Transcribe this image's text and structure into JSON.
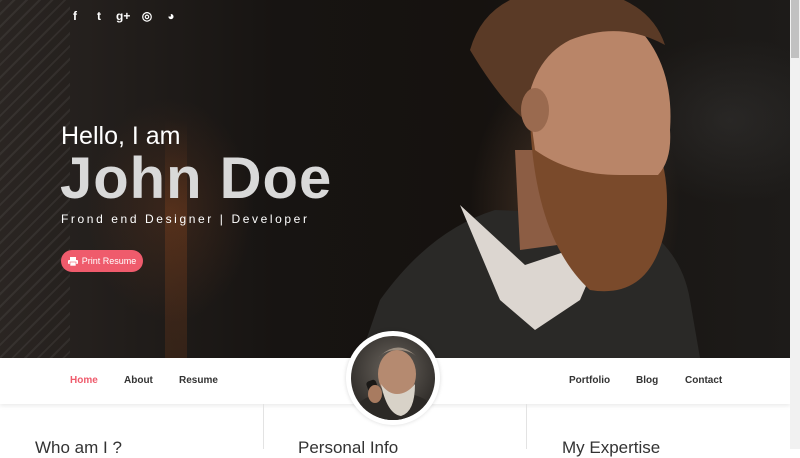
{
  "social": {
    "items": [
      {
        "icon": "facebook-icon",
        "glyph": "f"
      },
      {
        "icon": "twitter-icon",
        "glyph": "t"
      },
      {
        "icon": "google-plus-icon",
        "glyph": "g+"
      },
      {
        "icon": "instagram-icon",
        "glyph": "◎"
      },
      {
        "icon": "github-icon",
        "glyph": "◕"
      }
    ]
  },
  "hero": {
    "greeting": "Hello, I am",
    "name": "John Doe",
    "role": "Frond end Designer | Developer",
    "print_button": "Print Resume"
  },
  "nav": {
    "left": [
      "Home",
      "About",
      "Resume"
    ],
    "right": [
      "Portfolio",
      "Blog",
      "Contact"
    ],
    "active": "Home"
  },
  "sections": {
    "titles": [
      "Who am I ?",
      "Personal Info",
      "My Expertise"
    ]
  },
  "colors": {
    "accent": "#ef5b6c",
    "nav_text": "#333333"
  }
}
